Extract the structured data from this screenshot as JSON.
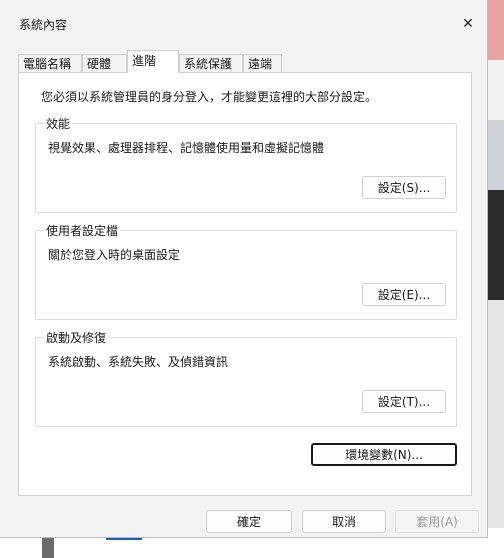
{
  "window": {
    "title": "系統內容",
    "close_glyph": "✕"
  },
  "tabs": [
    {
      "label": "電腦名稱",
      "active": false
    },
    {
      "label": "硬體",
      "active": false
    },
    {
      "label": "進階",
      "active": true
    },
    {
      "label": "系統保護",
      "active": false
    },
    {
      "label": "遠端",
      "active": false
    }
  ],
  "panel": {
    "notice": "您必須以系統管理員的身分登入，才能變更這裡的大部分設定。",
    "performance": {
      "label": "效能",
      "description": "視覺效果、處理器排程、記憶體使用量和虛擬記憶體",
      "button": "設定(S)..."
    },
    "user_profiles": {
      "label": "使用者設定檔",
      "description": "關於您登入時的桌面設定",
      "button": "設定(E)..."
    },
    "startup_recovery": {
      "label": "啟動及修復",
      "description": "系統啟動、系統失敗、及偵錯資訊",
      "button": "設定(T)..."
    },
    "env_button": "環境變數(N)..."
  },
  "footer": {
    "ok": "確定",
    "cancel": "取消",
    "apply": "套用(A)"
  },
  "colors": {
    "dialog_bg": "#f3f3f3",
    "panel_bg": "#ffffff",
    "border": "#d0d0d0",
    "disabled_text": "#9a9a9a"
  }
}
